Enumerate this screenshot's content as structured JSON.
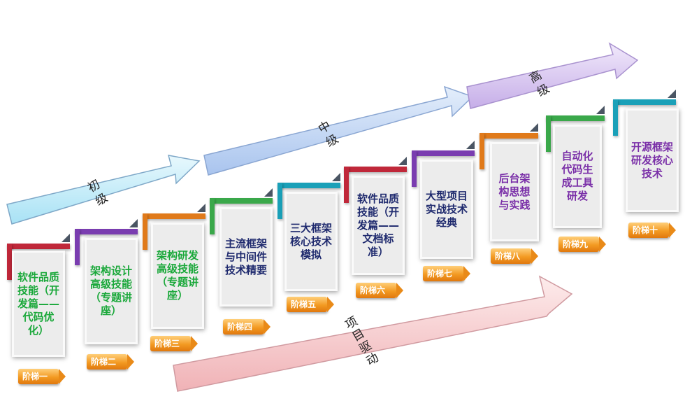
{
  "arrows": {
    "beginner": "初\n级",
    "intermediate": "中\n级",
    "advanced": "高\n级",
    "project": "项\n目\n驱\n动"
  },
  "steps": [
    {
      "badge": "阶梯一",
      "text": "软件品质技能（开发篇——代码优化）",
      "text_color": "#1aa83a",
      "accent": "#c0283a"
    },
    {
      "badge": "阶梯二",
      "text": "架构设计高级技能（专题讲座）",
      "text_color": "#1aa83a",
      "accent": "#7a3db0"
    },
    {
      "badge": "阶梯三",
      "text": "架构研发高级技能（专题讲座）",
      "text_color": "#1aa83a",
      "accent": "#e07a1a"
    },
    {
      "badge": "阶梯四",
      "text": "主流框架与中间件技术精要",
      "text_color": "#1f2a6e",
      "accent": "#3aa84a"
    },
    {
      "badge": "阶梯五",
      "text": "三大框架核心技术模拟",
      "text_color": "#1f2a6e",
      "accent": "#1aa0b8"
    },
    {
      "badge": "阶梯六",
      "text": "软件品质技能（开发篇——文档标准）",
      "text_color": "#1f2a6e",
      "accent": "#c0283a"
    },
    {
      "badge": "阶梯七",
      "text": "大型项目实战技术经典",
      "text_color": "#1f2a6e",
      "accent": "#7a3db0"
    },
    {
      "badge": "阶梯八",
      "text": "后台架构思想与实践",
      "text_color": "#7a2fa8",
      "accent": "#e07a1a"
    },
    {
      "badge": "阶梯九",
      "text": "自动化代码生成工具研发",
      "text_color": "#7a2fa8",
      "accent": "#3aa84a"
    },
    {
      "badge": "阶梯十",
      "text": "开源框架研发核心技术",
      "text_color": "#7a2fa8",
      "accent": "#1aa0b8"
    }
  ]
}
